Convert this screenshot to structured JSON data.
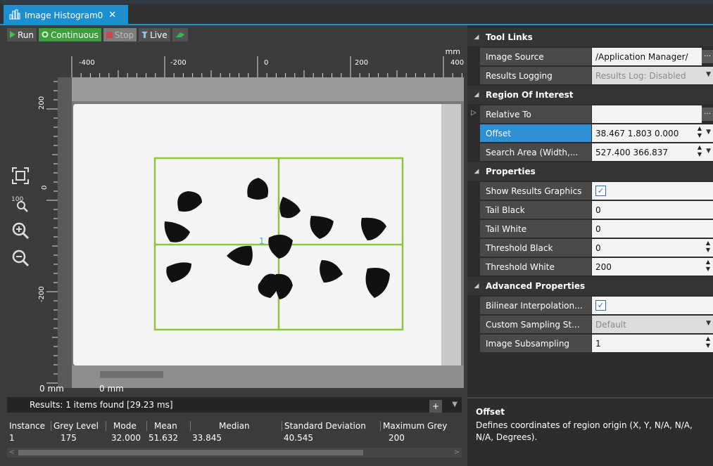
{
  "tab": {
    "title": "Image Histogram0",
    "close": "✕",
    "icon": "histogram-icon"
  },
  "toolbar": {
    "run": "Run",
    "continuous": "Continuous",
    "stop": "Stop",
    "live": "Live"
  },
  "ruler": {
    "unit_top": "mm",
    "top_ticks": [
      "-400",
      "-200",
      "0",
      "200",
      "400"
    ],
    "left_ticks": [
      "200",
      "0",
      "-200"
    ],
    "bottom_left_unit": "0 mm",
    "bottom_mid_unit": "0 mm"
  },
  "image": {
    "roi_center_label": "1"
  },
  "results": {
    "summary": "Results: 1 items found [29.23 ms]",
    "columns": [
      "Instance",
      "Grey Level",
      "Mode",
      "Mean",
      "Median",
      "Standard Deviation",
      "Maximum Grey"
    ],
    "rows": [
      [
        "1",
        "175",
        "32.000",
        "51.632",
        "33.845",
        "40.545",
        "200"
      ]
    ]
  },
  "properties": {
    "sections": {
      "tool_links": "Tool Links",
      "roi": "Region Of Interest",
      "props": "Properties",
      "advanced": "Advanced Properties"
    },
    "image_source": {
      "label": "Image Source",
      "value": "/Application Manager/"
    },
    "results_logging": {
      "label": "Results Logging",
      "value": "Results Log: Disabled"
    },
    "relative_to": {
      "label": "Relative To",
      "value": ""
    },
    "offset": {
      "label": "Offset",
      "value": "38.467 1.803 0.000"
    },
    "search_area": {
      "label": "Search Area (Width,...",
      "value": "527.400 366.837"
    },
    "show_graphics": {
      "label": "Show Results Graphics",
      "checked": true
    },
    "tail_black": {
      "label": "Tail Black",
      "value": "0"
    },
    "tail_white": {
      "label": "Tail White",
      "value": "0"
    },
    "threshold_black": {
      "label": "Threshold Black",
      "value": "0"
    },
    "threshold_white": {
      "label": "Threshold White",
      "value": "200"
    },
    "bilinear": {
      "label": "Bilinear Interpolation...",
      "checked": true
    },
    "custom_sampling": {
      "label": "Custom Sampling St...",
      "value": "Default"
    },
    "subsampling": {
      "label": "Image Subsampling",
      "value": "1"
    }
  },
  "description": {
    "title": "Offset",
    "body": "Defines coordinates of region origin (X, Y, N/A, N/A, N/A, Degrees)."
  }
}
